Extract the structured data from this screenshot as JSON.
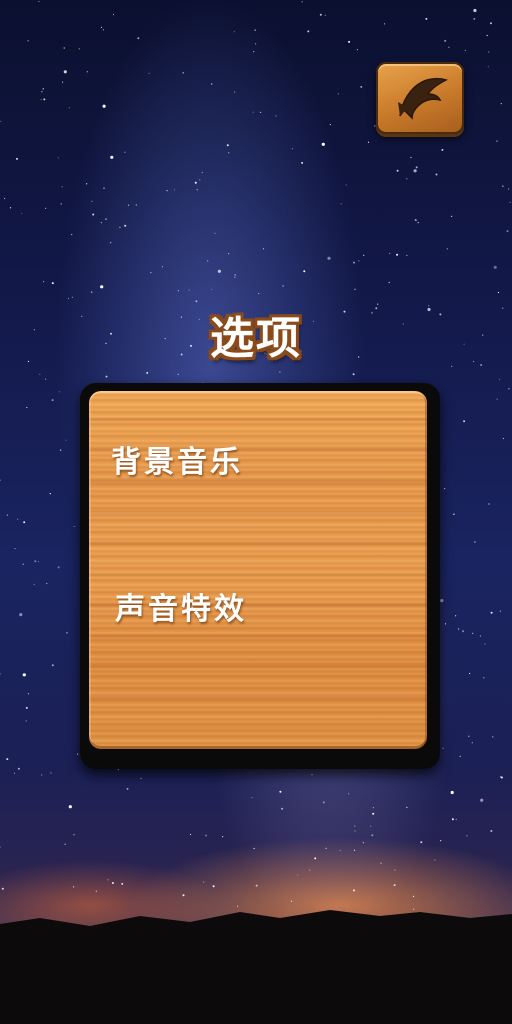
{
  "title": "选项",
  "options": [
    {
      "label": "背景音乐"
    },
    {
      "label": "声音特效"
    }
  ],
  "back_button": {
    "icon": "back-arrow-icon"
  },
  "colors": {
    "sky_top": "#0b1030",
    "sky_mid": "#1a2460",
    "horizon_glow": "#ff9646",
    "wood": "#e6974a",
    "wood_border": "#0a0a0a",
    "title_outline": "#8a4a1a",
    "button_wood": "#c87a2a"
  }
}
